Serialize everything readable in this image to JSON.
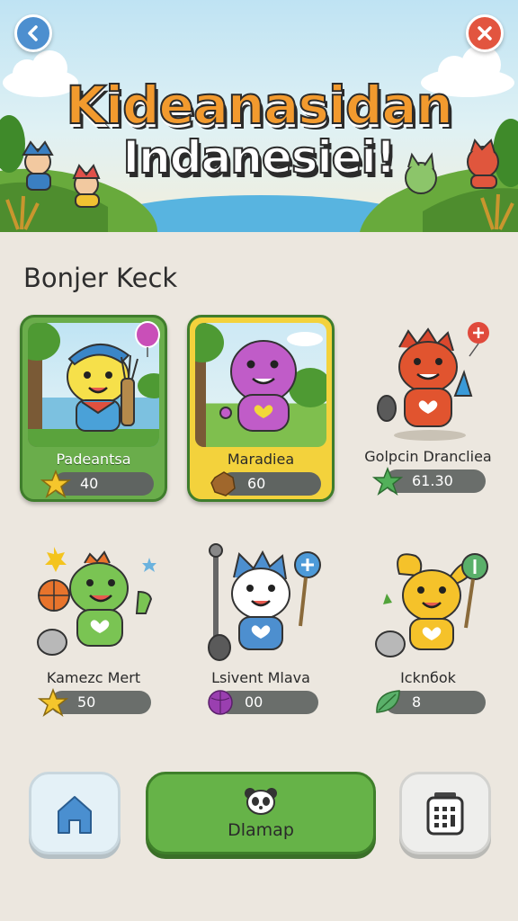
{
  "header": {
    "title_line1": "Kideanasidan",
    "title_line2": "Indanesiei!",
    "back_icon": "chevron-left-icon",
    "close_icon": "close-icon",
    "colors": {
      "back": "#4d8fcf",
      "close": "#e2553f"
    }
  },
  "section": {
    "title": "Bonjer Keck"
  },
  "cards": [
    {
      "name": "Padeantsa",
      "value": "40",
      "icon": "star-icon",
      "style": "green",
      "character": "yellow-bear-explorer"
    },
    {
      "name": "Maradiea",
      "value": "60",
      "icon": "cookie-icon",
      "style": "yellow",
      "character": "purple-blob"
    },
    {
      "name": "Golpcin Drancliea",
      "value": "61.30",
      "icon": "leaf-star-icon",
      "style": "plain",
      "character": "red-dragon"
    },
    {
      "name": "Kamezc Mert",
      "value": "50",
      "icon": "star-icon",
      "style": "plain",
      "character": "green-dino"
    },
    {
      "name": "Lsivent Mlava",
      "value": "00",
      "icon": "gem-icon",
      "style": "plain",
      "character": "blue-cat"
    },
    {
      "name": "Icknбok",
      "value": "8",
      "icon": "leaf-icon",
      "style": "plain",
      "character": "yellow-bunny"
    }
  ],
  "nav": {
    "home_icon": "home-icon",
    "map_label": "Dlamap",
    "map_icon": "panda-face-icon",
    "grid_icon": "calculator-grid-icon"
  },
  "palette": {
    "green": "#6aad4b",
    "yellow": "#f3d23c",
    "background": "#ece7df"
  }
}
